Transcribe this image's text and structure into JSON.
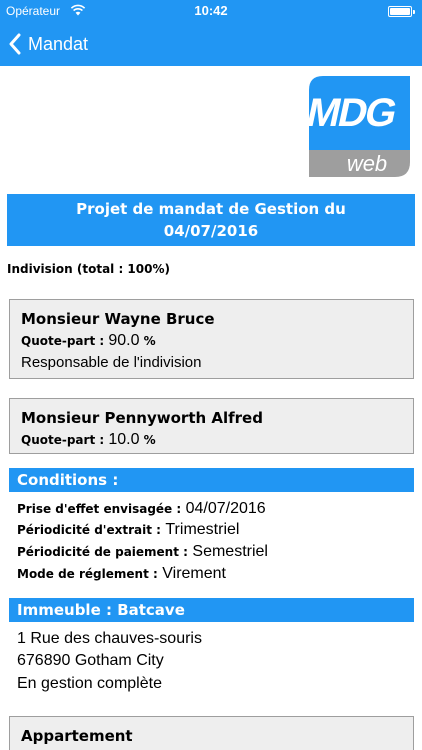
{
  "status_bar": {
    "carrier": "Opérateur",
    "time": "10:42"
  },
  "nav": {
    "back_label": "Mandat"
  },
  "logo": {
    "brand": "MDG",
    "sub": "web",
    "color": "#2196F3"
  },
  "header": {
    "title_line1": "Projet de mandat de Gestion du",
    "title_line2": "04/07/2016"
  },
  "indivision": "Indivision (total : 100%)",
  "owners": [
    {
      "name": "Monsieur Wayne Bruce",
      "quote_label": "Quote-part :",
      "quote_value": "90.0",
      "quote_unit": "%",
      "role": "Responsable de l'indivision"
    },
    {
      "name": "Monsieur Pennyworth Alfred",
      "quote_label": "Quote-part :",
      "quote_value": "10.0",
      "quote_unit": "%"
    }
  ],
  "conditions": {
    "title": "Conditions :",
    "fields": [
      {
        "label": "Prise d'effet envisagée :",
        "value": "04/07/2016"
      },
      {
        "label": "Périodicité d'extrait :",
        "value": "Trimestriel"
      },
      {
        "label": "Périodicité de paiement :",
        "value": "Semestriel"
      },
      {
        "label": "Mode de réglement :",
        "value": "Virement"
      }
    ]
  },
  "building": {
    "title": "Immeuble : Batcave",
    "address_line1": "1 Rue des chauves-souris",
    "address_line2": "676890 Gotham City",
    "status": "En gestion complète"
  },
  "lot": {
    "title": "Appartement"
  },
  "colors": {
    "primary": "#2196F3",
    "card_bg": "#eeeeee",
    "card_border": "#9e9e9e"
  }
}
